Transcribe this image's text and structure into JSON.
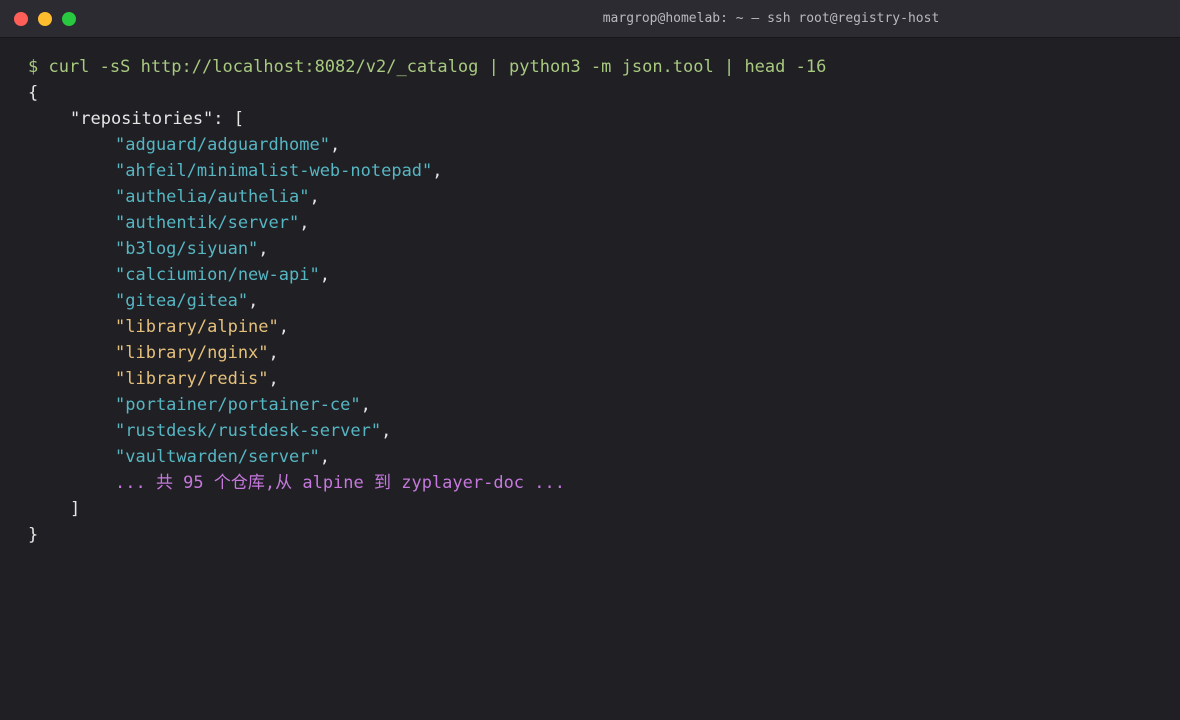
{
  "window": {
    "title": "margrop@homelab: ~ — ssh root@registry-host",
    "traffic_lights": [
      {
        "name": "close",
        "color": "#ff5f57"
      },
      {
        "name": "minimize",
        "color": "#febc2e"
      },
      {
        "name": "maximize",
        "color": "#28c840"
      }
    ]
  },
  "colors": {
    "background": "#1f1f24",
    "titlebar": "#2b2b31",
    "command": "#a8c97f",
    "string_default": "#56b6c2",
    "string_library": "#e5c07b",
    "summary": "#c678dd",
    "text": "#e6e6e6"
  },
  "terminal": {
    "command": "$ curl -sS http://localhost:8082/v2/_catalog | python3 -m json.tool | head -16",
    "open_brace": "{",
    "key_line": "\"repositories\": [",
    "repositories": [
      {
        "text": "\"adguard/adguardhome\"",
        "color": "#56b6c2"
      },
      {
        "text": "\"ahfeil/minimalist-web-notepad\"",
        "color": "#56b6c2"
      },
      {
        "text": "\"authelia/authelia\"",
        "color": "#56b6c2"
      },
      {
        "text": "\"authentik/server\"",
        "color": "#56b6c2"
      },
      {
        "text": "\"b3log/siyuan\"",
        "color": "#56b6c2"
      },
      {
        "text": "\"calciumion/new-api\"",
        "color": "#56b6c2"
      },
      {
        "text": "\"gitea/gitea\"",
        "color": "#56b6c2"
      },
      {
        "text": "\"library/alpine\"",
        "color": "#e5c07b"
      },
      {
        "text": "\"library/nginx\"",
        "color": "#e5c07b"
      },
      {
        "text": "\"library/redis\"",
        "color": "#e5c07b"
      },
      {
        "text": "\"portainer/portainer-ce\"",
        "color": "#56b6c2"
      },
      {
        "text": "\"rustdesk/rustdesk-server\"",
        "color": "#56b6c2"
      },
      {
        "text": "\"vaultwarden/server\"",
        "color": "#56b6c2"
      }
    ],
    "summary": "... 共 95 个仓库,从 alpine 到 zyplayer-doc ...",
    "close_bracket": "]",
    "close_brace": "}"
  }
}
